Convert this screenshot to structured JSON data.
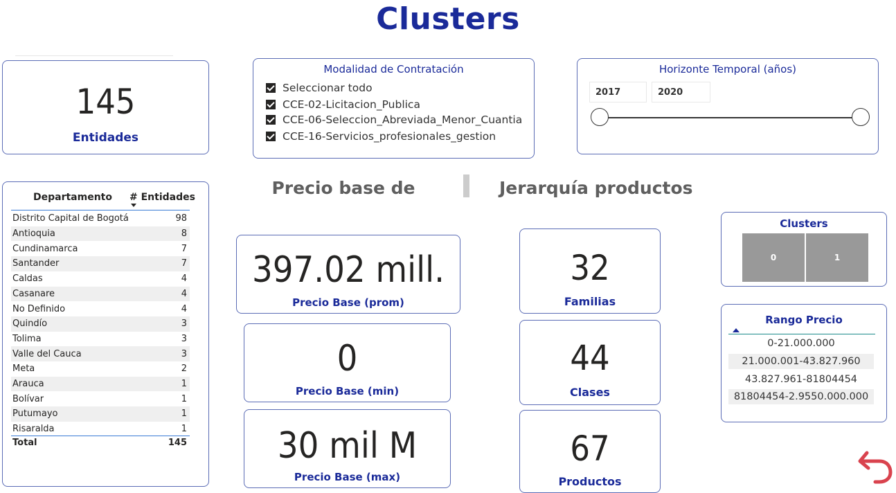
{
  "page": {
    "title": "Clusters"
  },
  "entidades_card": {
    "value": "145",
    "label": "Entidades"
  },
  "modalidad_slicer": {
    "title": "Modalidad de Contratación",
    "options": [
      {
        "label": "Seleccionar todo",
        "checked": true
      },
      {
        "label": "CCE-02-Licitacion_Publica",
        "checked": true
      },
      {
        "label": "CCE-06-Seleccion_Abreviada_Menor_Cuantia",
        "checked": true
      },
      {
        "label": "CCE-16-Servicios_profesionales_gestion",
        "checked": true
      }
    ]
  },
  "horizonte_slicer": {
    "title": "Horizonte Temporal (años)",
    "start": "2017",
    "end": "2020"
  },
  "departamento_table": {
    "columns": [
      "Departamento",
      "# Entidades"
    ],
    "rows": [
      [
        "Distrito Capital de Bogotá",
        "98"
      ],
      [
        "Antioquia",
        "8"
      ],
      [
        "Cundinamarca",
        "7"
      ],
      [
        "Santander",
        "7"
      ],
      [
        "Caldas",
        "4"
      ],
      [
        "Casanare",
        "4"
      ],
      [
        "No Definido",
        "4"
      ],
      [
        "Quindío",
        "3"
      ],
      [
        "Tolima",
        "3"
      ],
      [
        "Valle del Cauca",
        "3"
      ],
      [
        "Meta",
        "2"
      ],
      [
        "Arauca",
        "1"
      ],
      [
        "Bolívar",
        "1"
      ],
      [
        "Putumayo",
        "1"
      ],
      [
        "Risaralda",
        "1"
      ]
    ],
    "total_label": "Total",
    "total_value": "145"
  },
  "sections": {
    "precio_heading": "Precio base de",
    "jerarquia_heading": "Jerarquía productos"
  },
  "precio_cards": {
    "prom": {
      "value": "397.02 mill.",
      "label": "Precio Base (prom)"
    },
    "min": {
      "value": "0",
      "label": "Precio Base (min)"
    },
    "max": {
      "value": "30 mil M",
      "label": "Precio Base (max)"
    }
  },
  "jerarquia_cards": {
    "familias": {
      "value": "32",
      "label": "Familias"
    },
    "clases": {
      "value": "44",
      "label": "Clases"
    },
    "productos": {
      "value": "67",
      "label": "Productos"
    }
  },
  "clusters_slicer": {
    "title": "Clusters",
    "options": [
      "0",
      "1"
    ]
  },
  "rango_precio": {
    "title": "Rango Precio",
    "items": [
      "0-21.000.000",
      "21.000.001-43.827.960",
      "43.827.961-81804454",
      "81804454-2.9550.000.000"
    ]
  },
  "colors": {
    "accent": "#1a2a99",
    "back_arrow": "#d9434e",
    "cluster_tile": "#999999"
  },
  "icons": {
    "back": "undo-arrow-icon",
    "sort": "sort-down-icon"
  }
}
